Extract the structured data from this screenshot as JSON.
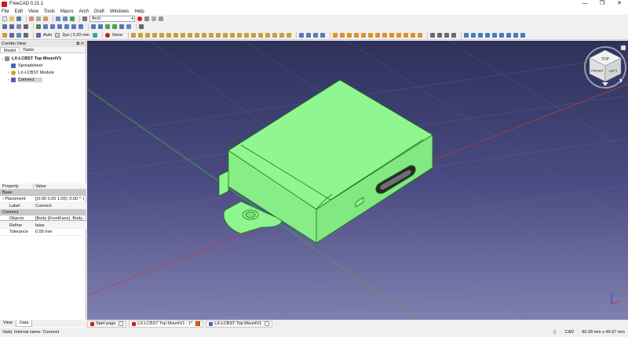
{
  "window": {
    "title": "FreeCAD 0.21.1",
    "controls": [
      "—",
      "❐",
      "✕"
    ]
  },
  "menu": [
    "File",
    "Edit",
    "View",
    "Tools",
    "Macro",
    "Arch",
    "Draft",
    "Windows",
    "Help"
  ],
  "toolbar": {
    "workbench": "Arch",
    "auto_label": "Auto",
    "line_width": "2px | 0.20 mm",
    "none_label": "None"
  },
  "combo_view": {
    "title": "Combo View",
    "tabs": [
      "Model",
      "Tasks"
    ],
    "tree": [
      {
        "label": "LX-LCBST Top MountV1",
        "icon": "document-icon",
        "color": "#777777"
      },
      {
        "label": "Spreadsheet",
        "icon": "spreadsheet-icon",
        "color": "#4a6e9a"
      },
      {
        "label": "LX-LCBST Module",
        "icon": "part-icon",
        "color": "#d8a020"
      },
      {
        "label": "Connect",
        "icon": "connect-icon",
        "color": "#5a5aa8"
      }
    ],
    "properties": {
      "headers": [
        "Property",
        "Value"
      ],
      "groups": [
        {
          "name": "Base",
          "rows": [
            {
              "name": "Placement",
              "value": "[(0.00 0.00 1.00); 0.00 °; (0..."
            },
            {
              "name": "Label",
              "value": "Connect"
            }
          ]
        },
        {
          "name": "Connect",
          "rows": [
            {
              "name": "Objects",
              "value": "[Body (FrontFace), Body..."
            },
            {
              "name": "Refine",
              "value": "false"
            },
            {
              "name": "Tolerance",
              "value": "0.00 mm"
            }
          ]
        }
      ]
    },
    "bottom_tabs": [
      "View",
      "Data"
    ]
  },
  "navcube": {
    "faces": [
      "TOP",
      "FRONT",
      "LEFT"
    ]
  },
  "document_tabs": [
    {
      "label": "Start page",
      "icon": "start-page-icon"
    },
    {
      "label": "LX-LCBST Top MountV1 : 1*",
      "icon": "freecad-doc-icon"
    },
    {
      "label": "LX-LCBST Top MountV1",
      "icon": "spreadsheet-icon"
    }
  ],
  "status": {
    "message": "Valid, Internal name: Connect",
    "nav_style": "CAD",
    "dimensions": "90.28 mm x 46.67 mm"
  },
  "colors": {
    "model_fill": "#8ff58f",
    "model_edge": "#1a7a1a",
    "background_top": "#2e325a",
    "background_bottom": "#8080b0"
  }
}
